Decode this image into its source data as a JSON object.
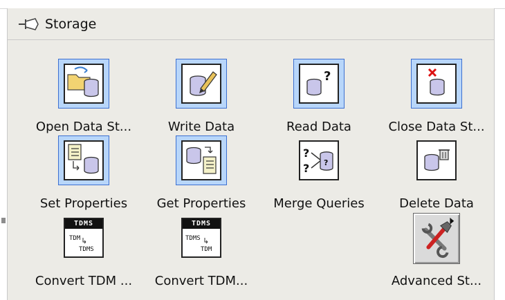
{
  "palette": {
    "title": "Storage",
    "items": [
      {
        "label": "Open Data St...",
        "icon": "open-data-storage-icon"
      },
      {
        "label": "Write Data",
        "icon": "write-data-icon"
      },
      {
        "label": "Read Data",
        "icon": "read-data-icon"
      },
      {
        "label": "Close Data St...",
        "icon": "close-data-storage-icon"
      },
      {
        "label": "Set Properties",
        "icon": "set-properties-icon"
      },
      {
        "label": "Get Properties",
        "icon": "get-properties-icon"
      },
      {
        "label": "Merge Queries",
        "icon": "merge-queries-icon"
      },
      {
        "label": "Delete Data",
        "icon": "delete-data-icon"
      },
      {
        "label": "Convert TDM ...",
        "icon": "convert-tdm-to-tdms-icon",
        "banner": "TDMS"
      },
      {
        "label": "Convert TDM...",
        "icon": "convert-tdms-to-tdm-icon",
        "banner": "TDMS"
      },
      {
        "label": "Advanced St...",
        "icon": "advanced-storage-icon"
      }
    ]
  },
  "colors": {
    "palette_bg": "#ecebe6",
    "selection_bg": "#b8d6fa",
    "selection_border": "#3c6fd0",
    "cylinder_fill": "#c9c6ea"
  }
}
